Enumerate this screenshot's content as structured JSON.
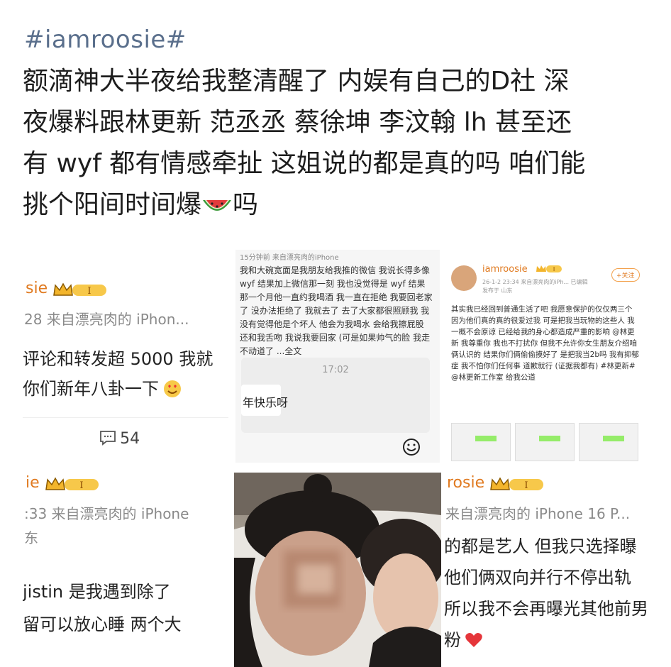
{
  "post": {
    "hashtag": "#iamroosie#",
    "line1": "额滴神大半夜给我整清醒了 内娱有自己的D社 深",
    "line2": "夜爆料跟林更新 范丞丞 蔡徐坤 李汶翰 lh 甚至还",
    "line3": "有 wyf 都有情感牵扯 这姐说的都是真的吗 咱们能",
    "line4_a": "挑个阳间时间爆",
    "line4_b": "吗"
  },
  "cell1": {
    "username": "sie",
    "level": "I",
    "meta": "28  来自漂亮肉的 iPhon...",
    "text1": "评论和转发超 5000 我就",
    "text2": "你们新年八卦一下",
    "comment_count": "54"
  },
  "cell2": {
    "header": "15分钟前  来自漂亮肉的iPhone",
    "text": "我和大碗宽面是我朋友给我推的微信 我说长得多像 wyf 结果加上微信那一刻 我也没觉得是 wyf 结果那一个月他一直约我喝酒 我一直在拒绝 我要回老家了 没办法拒绝了 我就去了 去了大家都很照顾我 我没有觉得他是个坏人 他会为我喝水 会给我擦屁股 还和我舌吻 我说我要回家 (可是如果帅气的脸 我走不动道了 ...全文",
    "chat_time": "17:02",
    "chat_msg": "年快乐呀"
  },
  "cell3": {
    "username": "iamroosie",
    "level": "I",
    "meta": "26-1-2 23:34  来自漂亮肉的iPh... 已编辑",
    "location": "发布于 山东",
    "follow": "+关注",
    "text": "其实我已经回到普通生活了吧 我愿意保护的仅仅两三个 因为他们真的真的很爱过我 可是把我当玩物的这些人 我一概不会原谅 已经给我的身心都造成严重的影响 @林更新 我尊重你 我也不打扰你 但我不允许你女生朋友介绍咱俩认识的 结果你们俩偷偷摸好了 是把我当2b吗 我有抑郁症 我不怕你们任何事 道歉就行 (证据我都有) #林更新# @林更新工作室 给我公道"
  },
  "cell4": {
    "username": "ie",
    "level": "I",
    "meta": ":33  来自漂亮肉的 iPhone",
    "location": "东",
    "text1": "jistin 是我遇到除了",
    "text2": "留可以放心睡 两个大"
  },
  "cell6": {
    "username": "rosie",
    "level": "I",
    "meta": "来自漂亮肉的 iPhone 16 P...",
    "text1": "的都是艺人 但我只选择曝",
    "text2": "他们俩双向并行不停出轨",
    "text3": "所以我不会再曝光其他前男",
    "text4": "粉"
  },
  "colors": {
    "hashtag": "#5a6f8c",
    "username": "#e07a20",
    "meta": "#8a8a8a",
    "chat_bubble": "#95ec69"
  },
  "icons": [
    "watermelon-icon",
    "crown-badge-icon",
    "comment-icon",
    "emoji-icon",
    "heart-icon"
  ]
}
